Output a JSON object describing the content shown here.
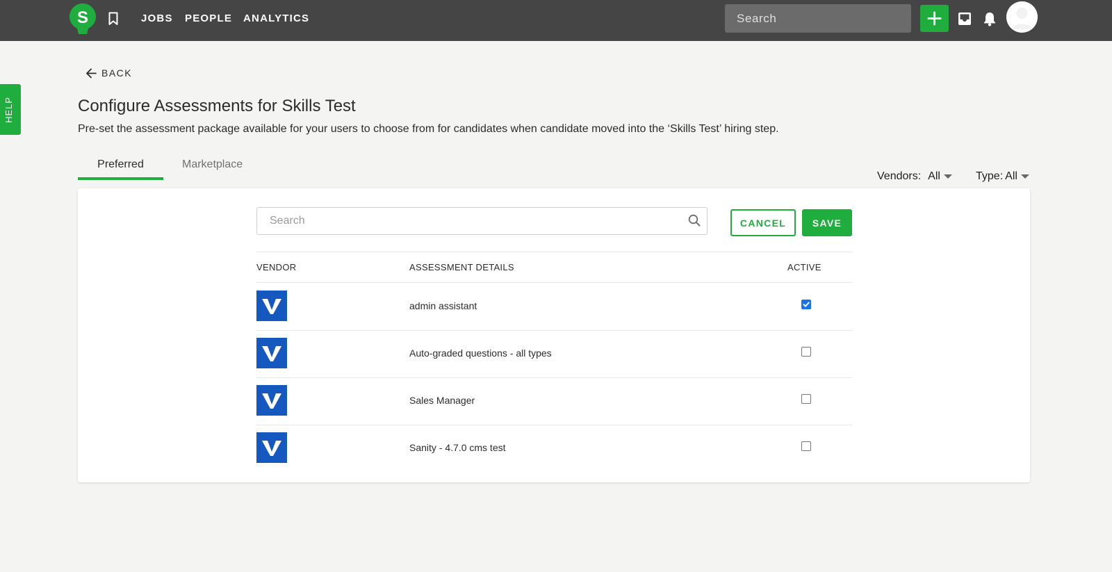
{
  "header": {
    "logo_letter": "S",
    "nav": [
      "JOBS",
      "PEOPLE",
      "ANALYTICS"
    ],
    "search_placeholder": "Search",
    "accent": "#1fad3e",
    "bar_color": "#454545",
    "icons": [
      "bookmark-icon",
      "plus-icon",
      "inbox-icon",
      "bell-icon",
      "avatar"
    ]
  },
  "help": {
    "label": "HELP"
  },
  "back": {
    "label": "BACK"
  },
  "page": {
    "title": "Configure Assessments for Skills Test",
    "subtitle": "Pre-set the assessment package available for your users to choose from for candidates when candidate moved into the ‘Skills Test’ hiring step."
  },
  "tabs": [
    {
      "label": "Preferred",
      "active": true
    },
    {
      "label": "Marketplace",
      "active": false
    }
  ],
  "filters": {
    "vendors": {
      "label": "Vendors:",
      "value": "All"
    },
    "type": {
      "label": "Type:",
      "value": "All"
    }
  },
  "list": {
    "search_placeholder": "Search",
    "cancel_label": "CANCEL",
    "save_label": "SAVE",
    "columns": {
      "vendor": "VENDOR",
      "details": "ASSESSMENT DETAILS",
      "active": "ACTIVE"
    },
    "vendor_logo_color": "#1558c0",
    "rows": [
      {
        "name": "admin assistant",
        "active": true
      },
      {
        "name": "Auto-graded questions - all types",
        "active": false
      },
      {
        "name": "Sales Manager",
        "active": false
      },
      {
        "name": "Sanity - 4.7.0 cms test",
        "active": false
      }
    ]
  }
}
